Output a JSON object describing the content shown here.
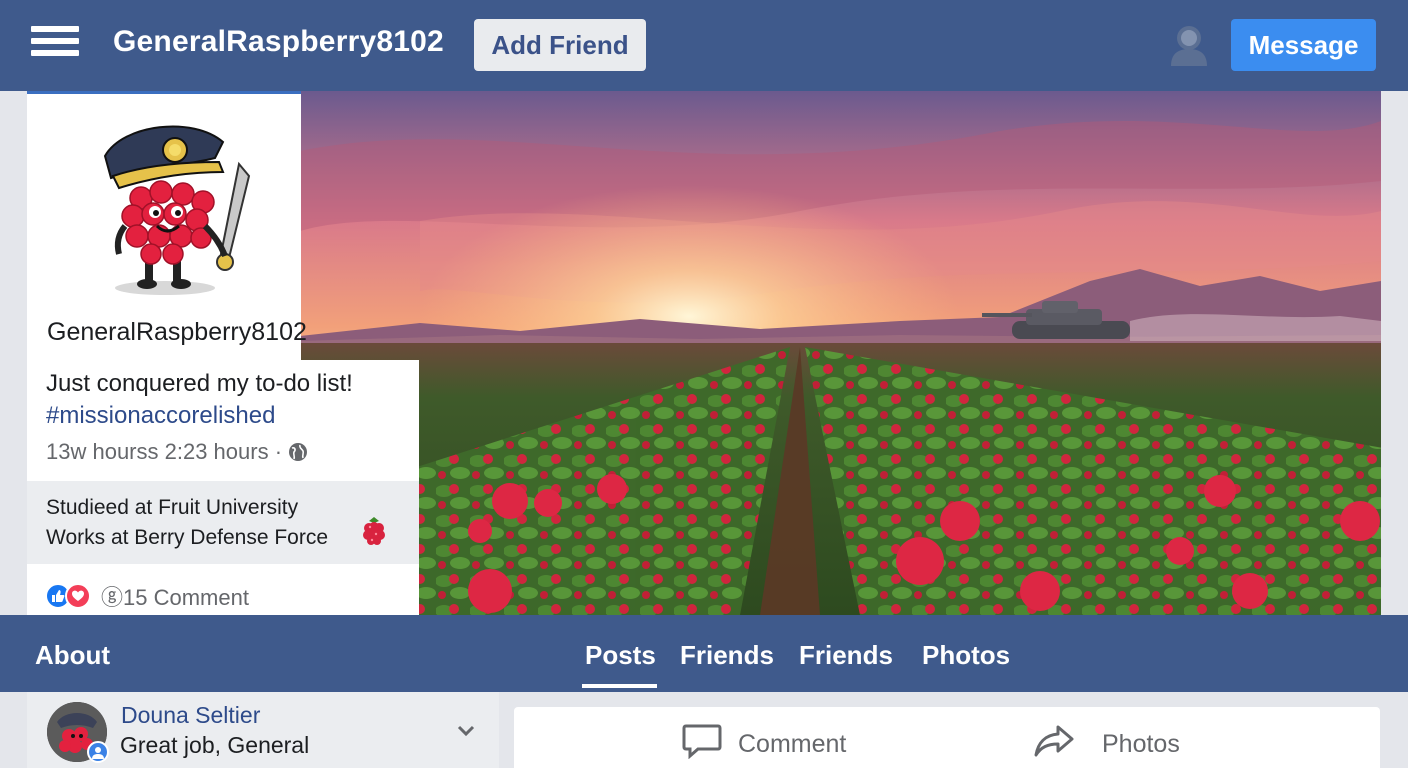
{
  "header": {
    "menu_icon": "hamburger-icon",
    "profile_name": "GeneralRaspberry8102",
    "add_friend_label": "Add Friend",
    "profile_icon": "user-silhouette-icon",
    "message_label": "Message"
  },
  "profile": {
    "username": "GeneralRaspberry8102"
  },
  "post": {
    "text_line1": "Just conquered my to-do list!",
    "hashtag": "#missionaccorelished",
    "meta": "13w hourss 2:23 hours ·",
    "studied": "Studieed at Fruit University",
    "works": "Works at Berry Defense Force",
    "comments": "15 Comment",
    "comment_prefix": "ⓖ"
  },
  "nav": {
    "about": "About",
    "tabs": [
      "Posts",
      "Friends",
      "Friends",
      "Photos"
    ],
    "active_tab": "Posts"
  },
  "comment": {
    "name": "Douna Seltier",
    "text": "Great job, General"
  },
  "actions": {
    "comment_label": "Comment",
    "photos_label": "Photos"
  },
  "colors": {
    "header_bg": "#3f5a8c",
    "accent_blue": "#3b8df0",
    "link_blue": "#2d4a8a"
  }
}
